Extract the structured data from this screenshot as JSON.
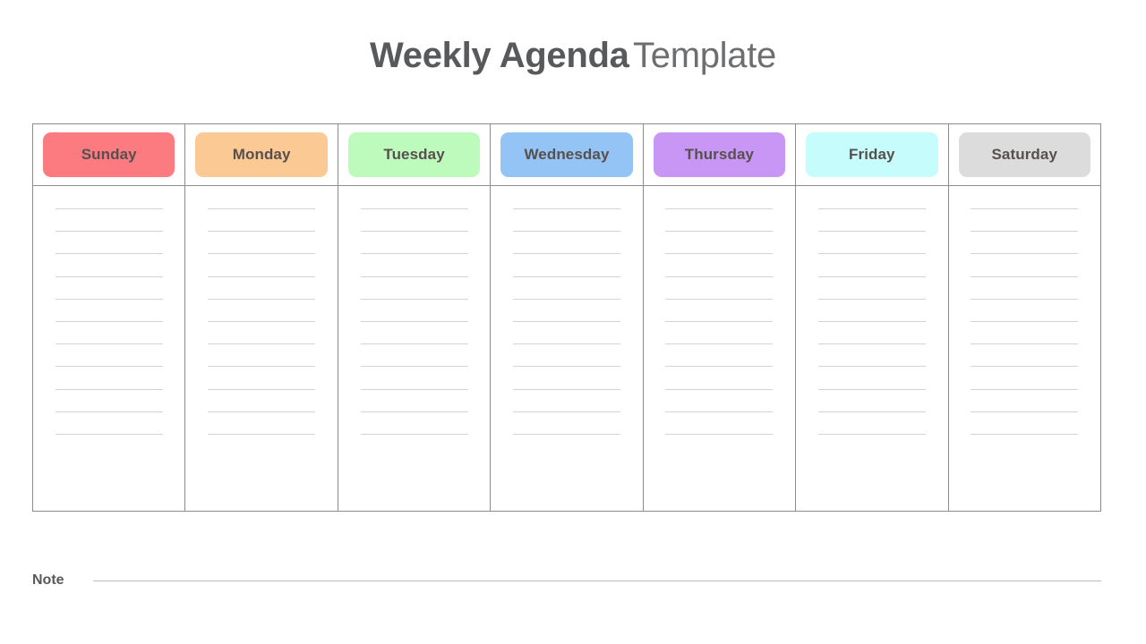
{
  "title": {
    "bold_part": "Weekly Agenda",
    "light_part": "Template"
  },
  "calendar": {
    "rules_per_day": 11,
    "days": [
      {
        "label": "Sunday",
        "chip_color": "#fb7b81"
      },
      {
        "label": "Monday",
        "chip_color": "#fbc994"
      },
      {
        "label": "Tuesday",
        "chip_color": "#bdfbbd"
      },
      {
        "label": "Wednesday",
        "chip_color": "#93c4f5"
      },
      {
        "label": "Thursday",
        "chip_color": "#c897f5"
      },
      {
        "label": "Friday",
        "chip_color": "#c6fcfc"
      },
      {
        "label": "Saturday",
        "chip_color": "#dcdcdc"
      }
    ]
  },
  "note": {
    "label": "Note"
  },
  "colors": {
    "title_bold": "#58595b",
    "title_light": "#6d6e70",
    "table_border": "#8c8c8c",
    "rule_line": "#d3d3d3",
    "note_line": "#bcbcbc",
    "page_background": "#ffffff"
  }
}
